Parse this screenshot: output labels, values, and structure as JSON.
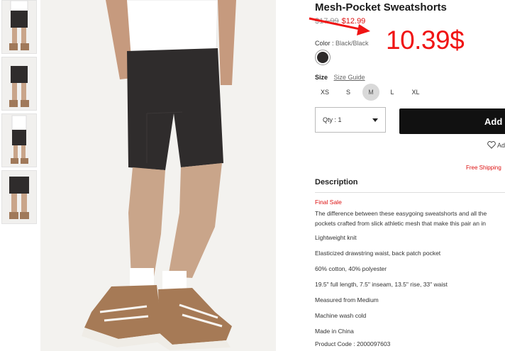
{
  "product": {
    "title": "Mesh-Pocket Sweatshorts",
    "old_price": "$17.99",
    "sale_price": "$12.99",
    "annotation_price": "10.39$",
    "color_label": "Color :",
    "color_value": "Black/Black",
    "size_label": "Size",
    "size_guide": "Size Guide",
    "sizes": [
      "XS",
      "S",
      "M",
      "L",
      "XL"
    ],
    "selected_size": "M",
    "qty_label": "Qty : 1",
    "add_button": "Add",
    "wishlist": "Ad",
    "free_shipping": "Free Shipping"
  },
  "description": {
    "heading": "Description",
    "final_sale": "Final Sale",
    "text_line1": "The difference between these easygoing sweatshorts and all the",
    "text_line2": "pockets crafted from slick athletic mesh that make this pair an in",
    "bullets": [
      "Lightweight knit",
      "Elasticized drawstring waist, back patch pocket",
      "60% cotton, 40% polyester",
      "19.5\" full length, 7.5\" inseam, 13.5\" rise, 33\" waist",
      "Measured from Medium",
      "Machine wash cold",
      "Made in China",
      "Product Code : 2000097603"
    ]
  },
  "colors": {
    "accent_red": "#d11111",
    "annotation_red": "#f01414",
    "button_black": "#111111"
  }
}
